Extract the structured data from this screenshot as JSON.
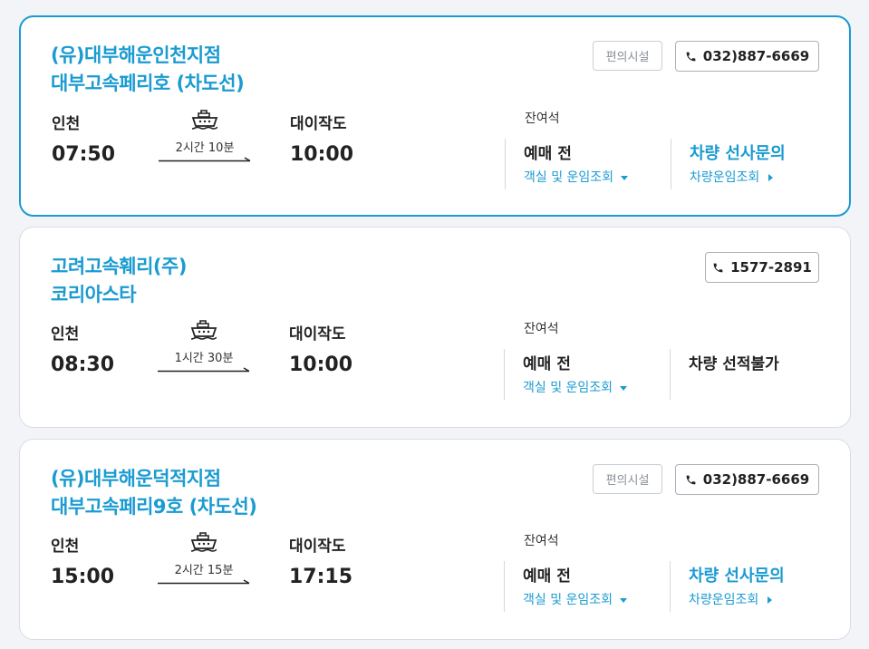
{
  "listings": [
    {
      "company": "(유)대부해운인천지점",
      "vessel": "대부고속페리호 (차도선)",
      "facilities_label": "편의시설",
      "phone": "032)887-6669",
      "departure_port": "인천",
      "departure_time": "07:50",
      "duration": "2시간 10분",
      "arrival_port": "대이작도",
      "arrival_time": "10:00",
      "seats_label": "잔여석",
      "status": "예매 전",
      "fare_link": "객실 및 운임조회",
      "vehicle_title": "차량 선사문의",
      "vehicle_link": "차량운임조회"
    },
    {
      "company": "고려고속훼리(주)",
      "vessel": "코리아스타",
      "facilities_label": "",
      "phone": "1577-2891",
      "departure_port": "인천",
      "departure_time": "08:30",
      "duration": "1시간 30분",
      "arrival_port": "대이작도",
      "arrival_time": "10:00",
      "seats_label": "잔여석",
      "status": "예매 전",
      "fare_link": "객실 및 운임조회",
      "vehicle_title": "차량 선적불가",
      "vehicle_link": ""
    },
    {
      "company": "(유)대부해운덕적지점",
      "vessel": "대부고속페리9호 (차도선)",
      "facilities_label": "편의시설",
      "phone": "032)887-6669",
      "departure_port": "인천",
      "departure_time": "15:00",
      "duration": "2시간 15분",
      "arrival_port": "대이작도",
      "arrival_time": "17:15",
      "seats_label": "잔여석",
      "status": "예매 전",
      "fare_link": "객실 및 운임조회",
      "vehicle_title": "차량 선사문의",
      "vehicle_link": "차량운임조회"
    }
  ],
  "colors": {
    "accent": "#1a9bd1",
    "text": "#222222",
    "border": "#d8dde3"
  },
  "icons": {
    "phone": "phone-icon",
    "ship": "ship-icon",
    "arrow": "arrow-icon"
  }
}
